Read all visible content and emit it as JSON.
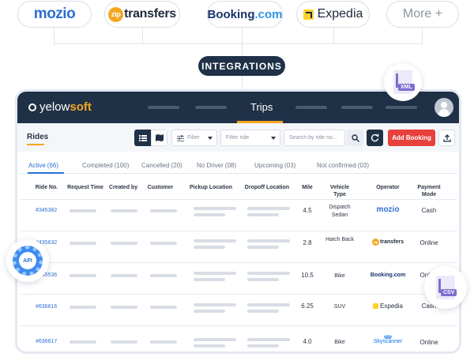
{
  "integrations_row": {
    "mozio": "mozio",
    "ziptransfers": "transfers",
    "zip_badge": "zip",
    "booking": "Booking",
    "booking_suffix": ".com",
    "expedia": "Expedia",
    "more": "More +"
  },
  "integrations_label": "INTEGRATIONS",
  "app": {
    "brand_prefix": "yelow",
    "brand_suffix": "soft",
    "nav_active": "Trips",
    "page_title": "Rides",
    "filter_placeholder": "Filter",
    "filter_ride_placeholder": "Filter ride",
    "search_placeholder": "Search by ride no...",
    "add_booking": "Add Booking"
  },
  "tabs": [
    {
      "label": "Active",
      "count": "(66)"
    },
    {
      "label": "Completed",
      "count": "(100)"
    },
    {
      "label": "Cancelled",
      "count": "(20)"
    },
    {
      "label": "No Driver",
      "count": "(08)"
    },
    {
      "label": "Upcoming",
      "count": "(03)"
    },
    {
      "label": "Not confirmed",
      "count": "(03)"
    }
  ],
  "columns": [
    "Ride No.",
    "Request Time",
    "Created by",
    "Customer",
    "Pickup Location",
    "Dropoff Location",
    "Mile",
    "Vehicle Type",
    "Operator",
    "Payment Mode"
  ],
  "rows": [
    {
      "ride_no": "#345382",
      "mile": "4.5",
      "vehicle": "Dispatch Sedan",
      "operator": "mozio",
      "payment": "Cash"
    },
    {
      "ride_no": "#435632",
      "mile": "2.8",
      "vehicle": "Hatch Back",
      "operator": "ziptransfers",
      "payment": "Online"
    },
    {
      "ride_no": "#345536",
      "mile": "10.5",
      "vehicle": "Bike",
      "operator": "Booking.com",
      "payment": "Online"
    },
    {
      "ride_no": "#636616",
      "mile": "6.25",
      "vehicle": "SUV",
      "operator": "Expedia",
      "payment": "Cash"
    },
    {
      "ride_no": "#636617",
      "mile": "4.0",
      "vehicle": "Bike",
      "operator": "Skyscanner",
      "payment": "Online"
    }
  ],
  "operators": {
    "mozio": "mozio",
    "zip_badge": "zip",
    "zip_text": "transfers",
    "booking": "Booking.com",
    "expedia": "Expedia",
    "skyscanner": "Skyscanner"
  },
  "badges": {
    "xml": "XML",
    "api": "API",
    "csv": "CSV"
  },
  "colors": {
    "navy": "#1f3147",
    "accent_orange": "#f5a623",
    "active_blue": "#2d6fd4",
    "add_red": "#e8403d"
  }
}
